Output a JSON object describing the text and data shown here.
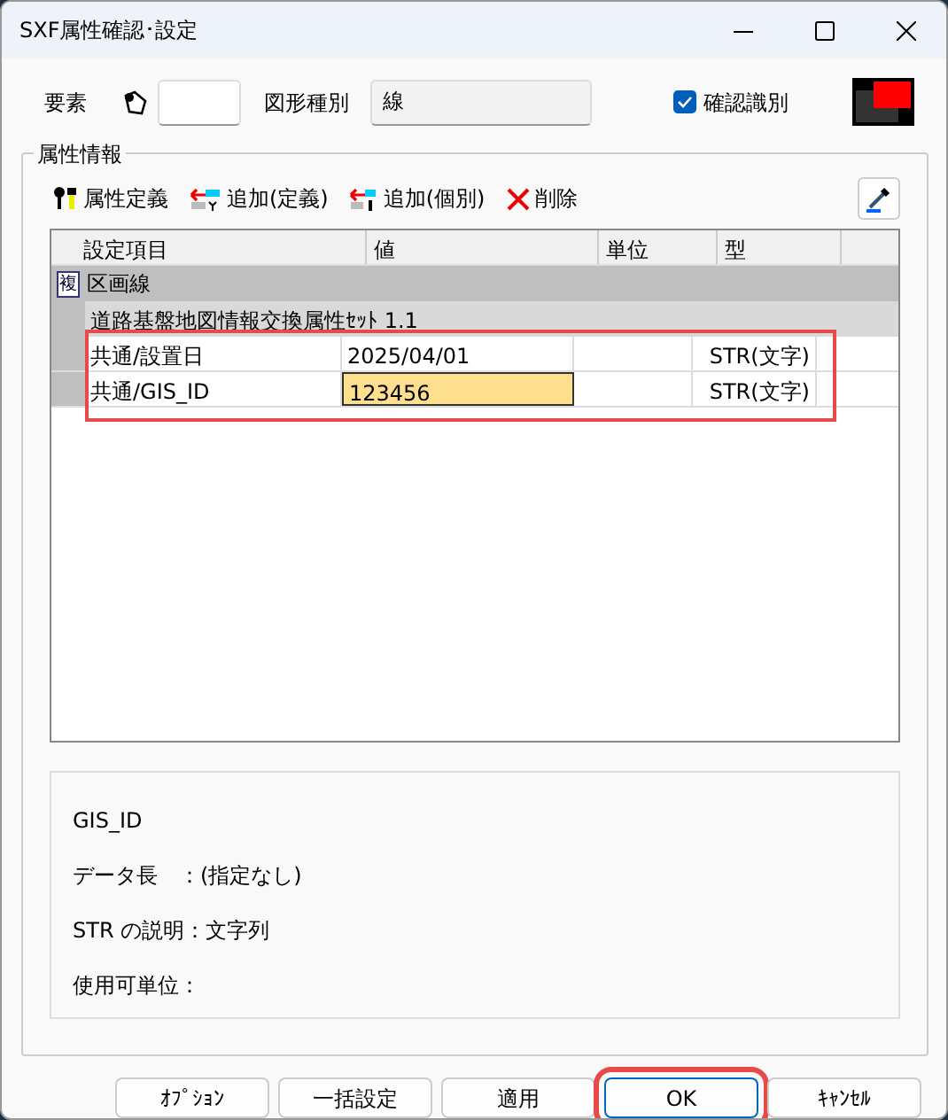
{
  "window": {
    "title": "SXF属性確認･設定"
  },
  "header": {
    "element_label": "要素",
    "shape_type_label": "図形種別",
    "shape_type_value": "線",
    "confirm": {
      "label": "確認識別",
      "checked": true
    }
  },
  "group": {
    "title": "属性情報"
  },
  "toolbar": [
    {
      "kind": "define",
      "label": "属性定義"
    },
    {
      "kind": "add-define",
      "label": "追加(定義)"
    },
    {
      "kind": "add-single",
      "label": "追加(個別)"
    },
    {
      "kind": "delete",
      "label": "削除"
    }
  ],
  "table": {
    "columns": [
      "設定項目",
      "値",
      "単位",
      "型"
    ],
    "layer_badge": "複",
    "layer": "区画線",
    "set_name": "道路基盤地図情報交換属性ｾｯﾄ 1.1",
    "rows": [
      {
        "item": "共通/設置日",
        "value": "2025/04/01",
        "unit": "",
        "type": "STR(文字)",
        "editing": false,
        "highlighted": true
      },
      {
        "item": "共通/GIS_ID",
        "value": "123456",
        "unit": "",
        "type": "STR(文字)",
        "editing": true,
        "highlighted": true
      }
    ]
  },
  "info": [
    "GIS_ID",
    "データ長　：(指定なし)",
    "STR の説明：文字列",
    "使用可単位："
  ],
  "buttons": [
    {
      "label": "ｵﾌﾟｼｮﾝ",
      "highlighted": false
    },
    {
      "label": "一括設定",
      "highlighted": false
    },
    {
      "label": "適用",
      "highlighted": false
    },
    {
      "label": "OK",
      "highlighted": true,
      "default": true
    },
    {
      "label": "ｷｬﾝｾﾙ",
      "highlighted": false
    }
  ]
}
